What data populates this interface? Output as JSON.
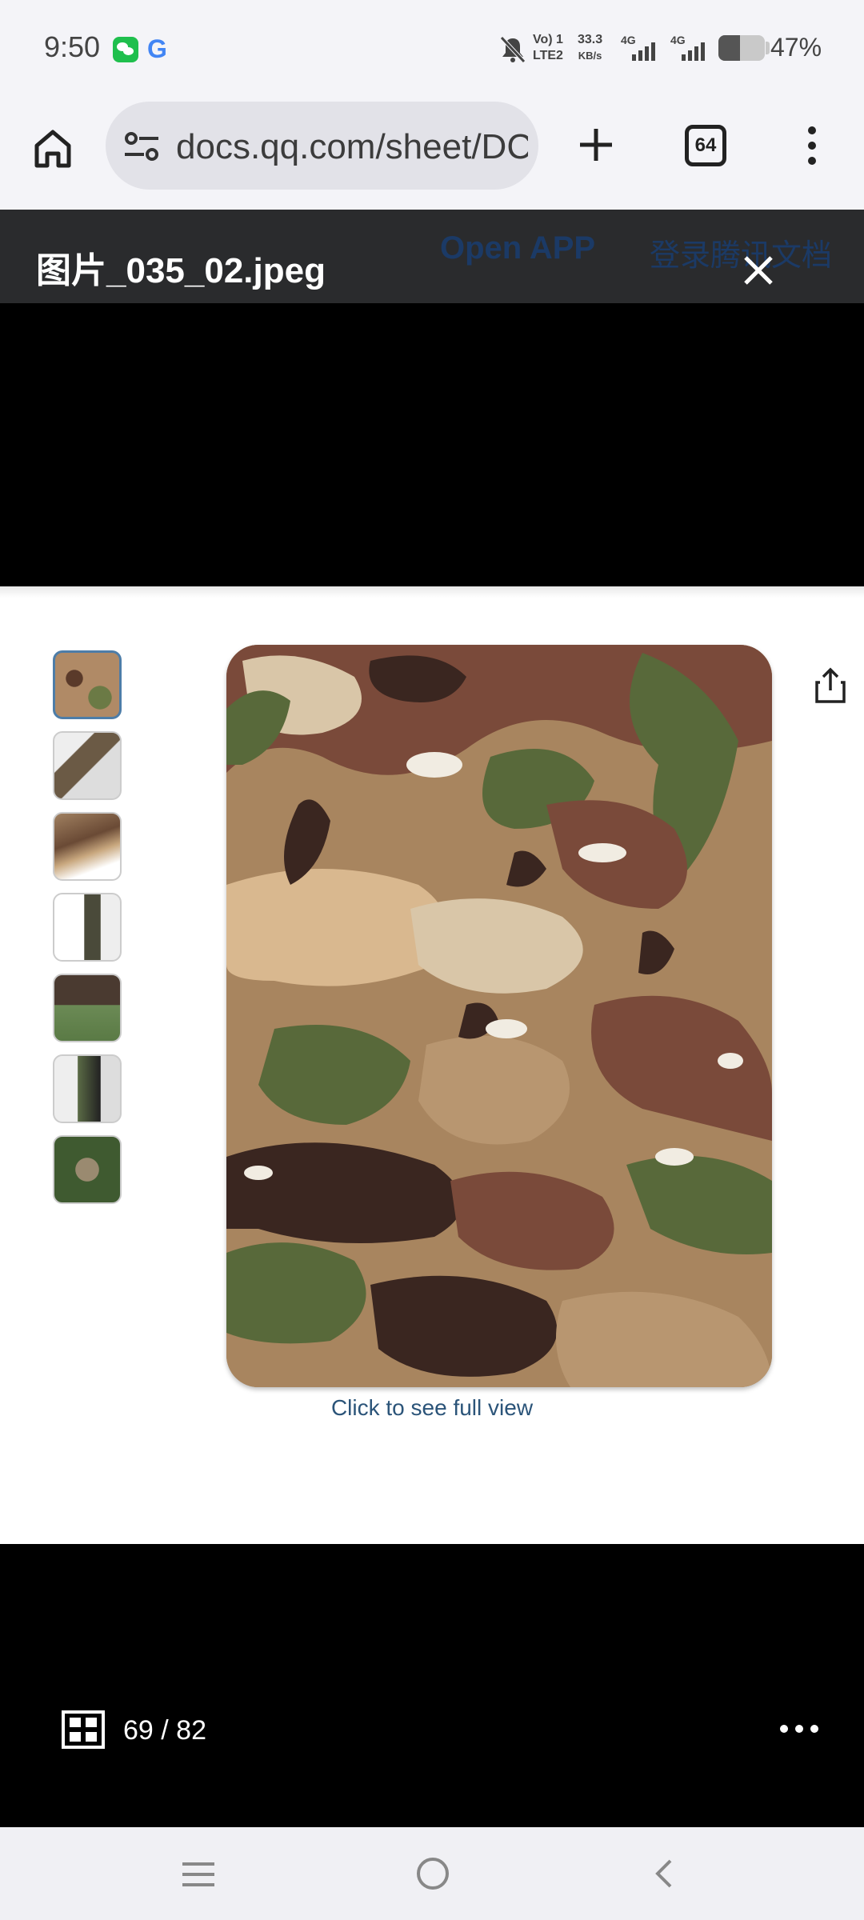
{
  "status_bar": {
    "time": "9:50",
    "volte_line1": "Vo) 1",
    "volte_line2": "LTE2",
    "speed_value": "33.3",
    "speed_unit": "KB/s",
    "network1": "4G",
    "network2": "4G",
    "battery_percent": "47%",
    "battery_level": 0.47,
    "icons": [
      "wechat-icon",
      "google-icon",
      "mute-icon",
      "signal-icon",
      "battery-icon"
    ]
  },
  "browser": {
    "url": "docs.qq.com/sheet/DC",
    "tab_count": "64",
    "icons": [
      "home-icon",
      "tune-icon",
      "plus-icon",
      "tabs-icon",
      "more-vert-icon"
    ]
  },
  "viewer": {
    "file_name": "图片_035_02.jpeg",
    "background_open_app": "Open APP",
    "background_login": "登录腾讯文档",
    "full_view_link": "Click to see full view",
    "page_counter": "69 / 82",
    "thumbnail_count": 7,
    "active_thumbnail": 1
  },
  "colors": {
    "camo_tan": "#a8855f",
    "camo_brown": "#7a4a3a",
    "camo_green": "#58693a",
    "camo_dark": "#3a2620",
    "camo_light": "#d9c6a8",
    "link": "#2b5479"
  },
  "nav_bar": {
    "icons": [
      "nav-menu-icon",
      "nav-home-icon",
      "nav-back-icon"
    ]
  }
}
